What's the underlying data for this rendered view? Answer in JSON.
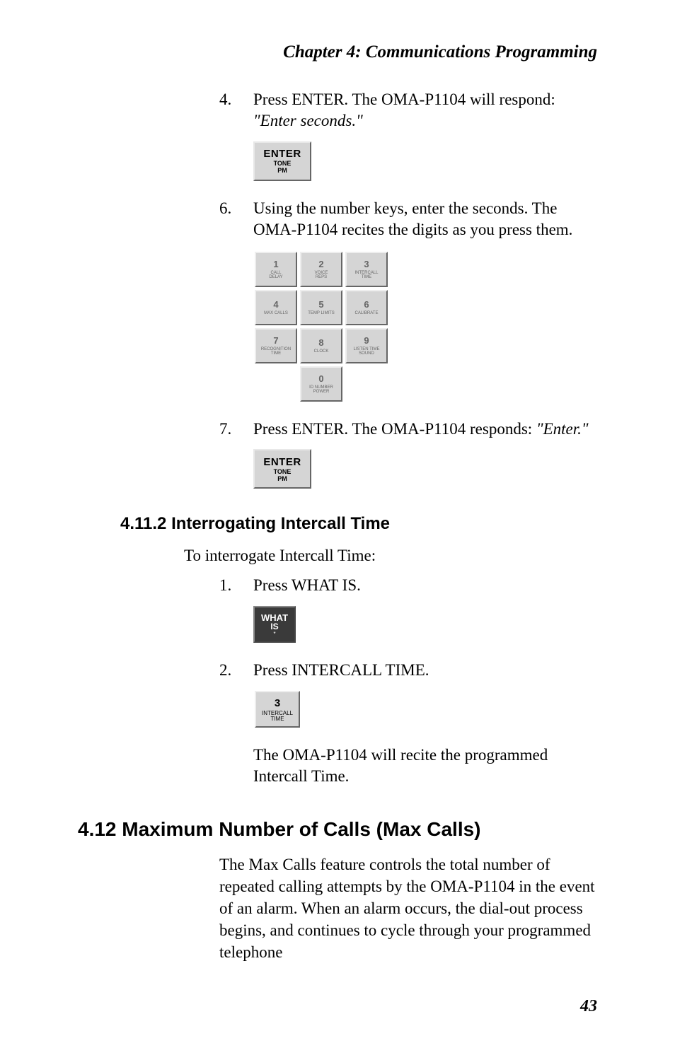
{
  "header": "Chapter 4: Communications Programming",
  "steps": {
    "s4": {
      "num": "4.",
      "text_a": "Press ENTER. The OMA-P1104 will respond: ",
      "quote": "\"Enter seconds.\""
    },
    "s6": {
      "num": "6.",
      "text": "Using the number keys, enter the seconds. The OMA-P1104 recites the digits as you press them."
    },
    "s7": {
      "num": "7.",
      "text_a": "Press ENTER. The OMA-P1104 responds: ",
      "quote": "\"Enter.\""
    },
    "s1b": {
      "num": "1.",
      "text": "Press WHAT IS."
    },
    "s2b": {
      "num": "2.",
      "text": "Press INTERCALL TIME.",
      "result": "The OMA-P1104 will recite the programmed Intercall Time."
    }
  },
  "enter_key": {
    "big": "ENTER",
    "line2": "TONE",
    "line3": "PM"
  },
  "whatis_key": {
    "line1": "WHAT",
    "line2": "IS",
    "line3": "*"
  },
  "intercall_key": {
    "digit": "3",
    "label1": "INTERCALL",
    "label2": "TIME"
  },
  "keypad": {
    "k1": {
      "d": "1",
      "l1": "CALL",
      "l2": "DELAY"
    },
    "k2": {
      "d": "2",
      "l1": "VOICE",
      "l2": "REPS"
    },
    "k3": {
      "d": "3",
      "l1": "INTERCALL",
      "l2": "TIME"
    },
    "k4": {
      "d": "4",
      "l1": "MAX CALLS",
      "l2": ""
    },
    "k5": {
      "d": "5",
      "l1": "TEMP LIMITS",
      "l2": ""
    },
    "k6": {
      "d": "6",
      "l1": "CALIBRATE",
      "l2": ""
    },
    "k7": {
      "d": "7",
      "l1": "RECOGNITION",
      "l2": "TIME"
    },
    "k8": {
      "d": "8",
      "l1": "CLOCK",
      "l2": ""
    },
    "k9": {
      "d": "9",
      "l1": "LISTEN TIME",
      "l2": "SOUND"
    },
    "k0": {
      "d": "0",
      "l1": "ID NUMBER",
      "l2": "POWER"
    }
  },
  "section_4_11_2": {
    "title": "4.11.2  Interrogating Intercall Time",
    "intro": "To interrogate Intercall Time:"
  },
  "section_4_12": {
    "title": "4.12  Maximum Number of Calls (Max Calls)",
    "para": "The Max Calls feature controls the total number of repeated calling attempts by the OMA-P1104 in the event of an alarm. When an alarm occurs, the dial-out process begins, and continues to cycle through your programmed telephone"
  },
  "page_number": "43"
}
